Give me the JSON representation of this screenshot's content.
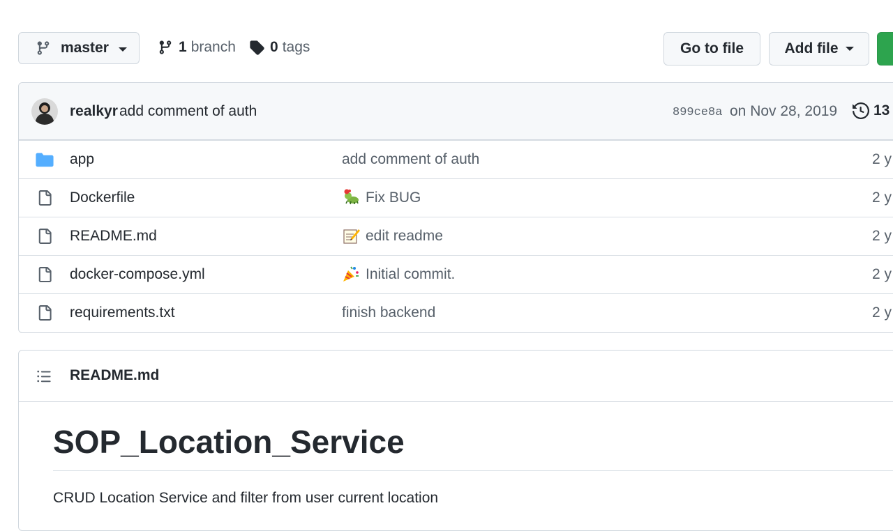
{
  "toolbar": {
    "branch_name": "master",
    "branch_count": "1",
    "branch_label": "branch",
    "tag_count": "0",
    "tag_label": "tags",
    "go_to_file": "Go to file",
    "add_file": "Add file"
  },
  "latest_commit": {
    "author": "realkyr",
    "message": "add comment of auth",
    "sha": "899ce8a",
    "date": "on Nov 28, 2019",
    "history_count": "13"
  },
  "files": [
    {
      "name": "app",
      "type": "folder",
      "commit_message": "add comment of auth",
      "emoji": "",
      "age": "2 y"
    },
    {
      "name": "Dockerfile",
      "type": "file",
      "commit_message": "Fix BUG",
      "emoji": "bug-emoji",
      "age": "2 y"
    },
    {
      "name": "README.md",
      "type": "file",
      "commit_message": "edit readme",
      "emoji": "memo-emoji",
      "age": "2 y"
    },
    {
      "name": "docker-compose.yml",
      "type": "file",
      "commit_message": "Initial commit.",
      "emoji": "party-popper-emoji",
      "age": "2 y"
    },
    {
      "name": "requirements.txt",
      "type": "file",
      "commit_message": "finish backend",
      "emoji": "",
      "age": "2 y"
    }
  ],
  "readme": {
    "header_title": "README.md",
    "heading": "SOP_Location_Service",
    "description": "CRUD Location Service and filter from user current location"
  },
  "colors": {
    "accent_green": "#2da44e",
    "folder_blue": "#54aeff",
    "border": "#d0d7de"
  }
}
